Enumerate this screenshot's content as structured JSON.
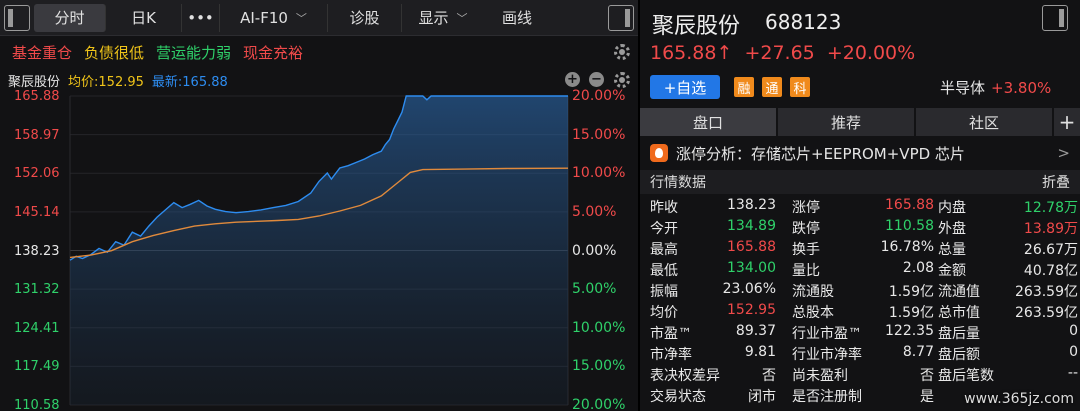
{
  "toolbar": {
    "tabs": [
      "分时",
      "日K",
      "•••",
      "AI-F10",
      "诊股",
      "显示",
      "画线"
    ],
    "ai_f10": "AI-F10",
    "display": "显示",
    "draw": "画线"
  },
  "tags": [
    {
      "label": "基金重仓",
      "color": "#f04a4a"
    },
    {
      "label": "负债很低",
      "color": "#f0c419"
    },
    {
      "label": "营运能力弱",
      "color": "#2fd16a"
    },
    {
      "label": "现金充裕",
      "color": "#f04a4a"
    }
  ],
  "info": {
    "name": "聚辰股份",
    "avg_label": "均价:152.95",
    "last_label": "最新:165.88"
  },
  "chart_data": {
    "type": "line",
    "y_price_ticks": [
      "165.88",
      "158.97",
      "152.06",
      "145.14",
      "138.23",
      "131.32",
      "124.41",
      "117.49",
      "110.58"
    ],
    "y_pct_ticks": [
      "20.00%",
      "15.00%",
      "10.00%",
      "5.00%",
      "0.00%",
      "5.00%",
      "10.00%",
      "15.00%",
      "20.00%"
    ],
    "ylim": [
      110.58,
      165.88
    ],
    "prev_close": 138.23,
    "x_steps": 240,
    "series": [
      {
        "color": "#2d8cf0",
        "points": [
          [
            0,
            136.5
          ],
          [
            3,
            137.2
          ],
          [
            6,
            136.8
          ],
          [
            10,
            137.5
          ],
          [
            14,
            138.6
          ],
          [
            18,
            137.9
          ],
          [
            22,
            139.8
          ],
          [
            26,
            139.2
          ],
          [
            30,
            141.5
          ],
          [
            34,
            140.8
          ],
          [
            38,
            142.6
          ],
          [
            42,
            144.2
          ],
          [
            46,
            145.5
          ],
          [
            50,
            146.8
          ],
          [
            54,
            145.9
          ],
          [
            58,
            146.5
          ],
          [
            62,
            147.2
          ],
          [
            66,
            146.2
          ],
          [
            70,
            145.6
          ],
          [
            75,
            145.2
          ],
          [
            80,
            145.0
          ],
          [
            86,
            145.2
          ],
          [
            92,
            145.5
          ],
          [
            98,
            145.9
          ],
          [
            104,
            146.3
          ],
          [
            110,
            147.0
          ],
          [
            116,
            148.5
          ],
          [
            120,
            150.6
          ],
          [
            124,
            152.1
          ],
          [
            126,
            151.0
          ],
          [
            130,
            153.0
          ],
          [
            134,
            153.4
          ],
          [
            138,
            154.0
          ],
          [
            142,
            154.6
          ],
          [
            146,
            155.4
          ],
          [
            150,
            156.0
          ],
          [
            152,
            157.2
          ],
          [
            154,
            158.1
          ],
          [
            156,
            160.0
          ],
          [
            158,
            161.5
          ],
          [
            160,
            163.0
          ],
          [
            162,
            165.88
          ],
          [
            170,
            165.88
          ],
          [
            172,
            165.2
          ],
          [
            174,
            165.88
          ],
          [
            240,
            165.88
          ]
        ]
      },
      {
        "color": "#e08a3c",
        "points": [
          [
            0,
            137.0
          ],
          [
            10,
            137.4
          ],
          [
            20,
            138.2
          ],
          [
            30,
            139.8
          ],
          [
            40,
            140.9
          ],
          [
            50,
            141.8
          ],
          [
            60,
            142.6
          ],
          [
            70,
            143.0
          ],
          [
            80,
            143.3
          ],
          [
            100,
            143.6
          ],
          [
            110,
            143.8
          ],
          [
            120,
            144.4
          ],
          [
            130,
            145.3
          ],
          [
            140,
            146.3
          ],
          [
            150,
            148.0
          ],
          [
            158,
            150.4
          ],
          [
            164,
            152.2
          ],
          [
            170,
            152.7
          ],
          [
            190,
            152.8
          ],
          [
            210,
            152.9
          ],
          [
            240,
            152.95
          ]
        ]
      }
    ]
  },
  "stock": {
    "name": "聚辰股份",
    "code": "688123",
    "price": "165.88↑",
    "change": "+27.65",
    "change_pct": "+20.00%",
    "add_label": "+自选",
    "badges": [
      "融",
      "通",
      "科"
    ],
    "sector": "半导体",
    "sector_chg": "+3.80%"
  },
  "rtabs": [
    "盘口",
    "推荐",
    "社区",
    "+"
  ],
  "analysis": {
    "label": "涨停分析：存储芯片+EEPROM+VPD 芯片",
    "chevron": ">"
  },
  "quotes_header": {
    "title": "行情数据",
    "fold": "折叠"
  },
  "quotes": [
    [
      {
        "l": "昨收",
        "v": "138.23",
        "c": "white"
      },
      {
        "l": "涨停",
        "v": "165.88",
        "c": "red"
      },
      {
        "l": "内盘",
        "v": "12.78万",
        "c": "green"
      }
    ],
    [
      {
        "l": "今开",
        "v": "134.89",
        "c": "green"
      },
      {
        "l": "跌停",
        "v": "110.58",
        "c": "green"
      },
      {
        "l": "外盘",
        "v": "13.89万",
        "c": "red"
      }
    ],
    [
      {
        "l": "最高",
        "v": "165.88",
        "c": "red"
      },
      {
        "l": "换手",
        "v": "16.78%",
        "c": "white"
      },
      {
        "l": "总量",
        "v": "26.67万",
        "c": "white"
      }
    ],
    [
      {
        "l": "最低",
        "v": "134.00",
        "c": "green"
      },
      {
        "l": "量比",
        "v": "2.08",
        "c": "white"
      },
      {
        "l": "金额",
        "v": "40.78亿",
        "c": "white"
      }
    ],
    [
      {
        "l": "振幅",
        "v": "23.06%",
        "c": "white"
      },
      {
        "l": "流通股",
        "v": "1.59亿",
        "c": "white"
      },
      {
        "l": "流通值",
        "v": "263.59亿",
        "c": "white"
      }
    ],
    [
      {
        "l": "均价",
        "v": "152.95",
        "c": "red"
      },
      {
        "l": "总股本",
        "v": "1.59亿",
        "c": "white"
      },
      {
        "l": "总市值",
        "v": "263.59亿",
        "c": "white"
      }
    ],
    [
      {
        "l": "市盈™",
        "v": "89.37",
        "c": "white"
      },
      {
        "l": "行业市盈™",
        "v": "122.35",
        "c": "white"
      },
      {
        "l": "盘后量",
        "v": "0",
        "c": "white"
      }
    ],
    [
      {
        "l": "市净率",
        "v": "9.81",
        "c": "white"
      },
      {
        "l": "行业市净率",
        "v": "8.77",
        "c": "white"
      },
      {
        "l": "盘后额",
        "v": "0",
        "c": "white"
      }
    ],
    [
      {
        "l": "表决权差异",
        "v": "否",
        "c": "white"
      },
      {
        "l": "尚未盈利",
        "v": "否",
        "c": "white"
      },
      {
        "l": "盘后笔数",
        "v": "--",
        "c": "white"
      }
    ],
    [
      {
        "l": "交易状态",
        "v": "闭市",
        "c": "white"
      },
      {
        "l": "是否注册制",
        "v": "是",
        "c": "white"
      },
      {
        "l": "",
        "v": "",
        "c": "white"
      }
    ]
  ],
  "watermark": "www.365jz.com",
  "colors": {
    "red": "#f04a4a",
    "green": "#2fd16a",
    "blue": "#2d8cf0",
    "orange": "#e08a3c",
    "yellow": "#f0c419"
  }
}
